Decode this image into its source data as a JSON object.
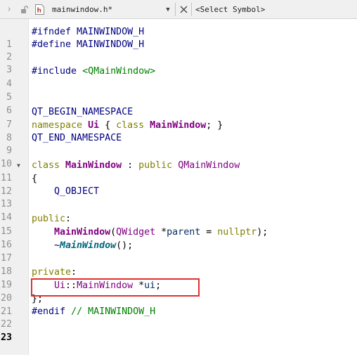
{
  "topbar": {
    "file_name": "mainwindow.h*",
    "symbol_placeholder": "<Select Symbol>",
    "nav_icon": "chevron-right-icon",
    "lock_icon": "unlock-icon",
    "file_icon": "header-file-icon",
    "dropdown_icon": "chevron-down-icon",
    "close_icon": "close-icon"
  },
  "colors": {
    "preprocessor": "#000080",
    "include_path": "#008000",
    "keyword": "#808000",
    "class_name": "#800080",
    "highlight_border": "#e03030"
  },
  "editor": {
    "current_line": 23,
    "lines": [
      {
        "n": "1",
        "t": "#ifndef MAINWINDOW_H"
      },
      {
        "n": "2",
        "t": "#define MAINWINDOW_H"
      },
      {
        "n": "3",
        "t": ""
      },
      {
        "n": "4",
        "t": "#include <QMainWindow>"
      },
      {
        "n": "5",
        "t": ""
      },
      {
        "n": "6",
        "t": ""
      },
      {
        "n": "7",
        "t": "QT_BEGIN_NAMESPACE"
      },
      {
        "n": "8",
        "t": "namespace Ui { class MainWindow; }"
      },
      {
        "n": "9",
        "t": "QT_END_NAMESPACE"
      },
      {
        "n": "10",
        "t": ""
      },
      {
        "n": "11",
        "t": "class MainWindow : public QMainWindow"
      },
      {
        "n": "12",
        "t": "{"
      },
      {
        "n": "13",
        "t": "    Q_OBJECT"
      },
      {
        "n": "14",
        "t": ""
      },
      {
        "n": "15",
        "t": "public:"
      },
      {
        "n": "16",
        "t": "    MainWindow(QWidget *parent = nullptr);"
      },
      {
        "n": "17",
        "t": "    ~MainWindow();"
      },
      {
        "n": "18",
        "t": ""
      },
      {
        "n": "19",
        "t": "private:"
      },
      {
        "n": "20",
        "t": "    Ui::MainWindow *ui;"
      },
      {
        "n": "21",
        "t": "};"
      },
      {
        "n": "22",
        "t": "#endif // MAINWINDOW_H"
      },
      {
        "n": "23",
        "t": ""
      }
    ]
  }
}
